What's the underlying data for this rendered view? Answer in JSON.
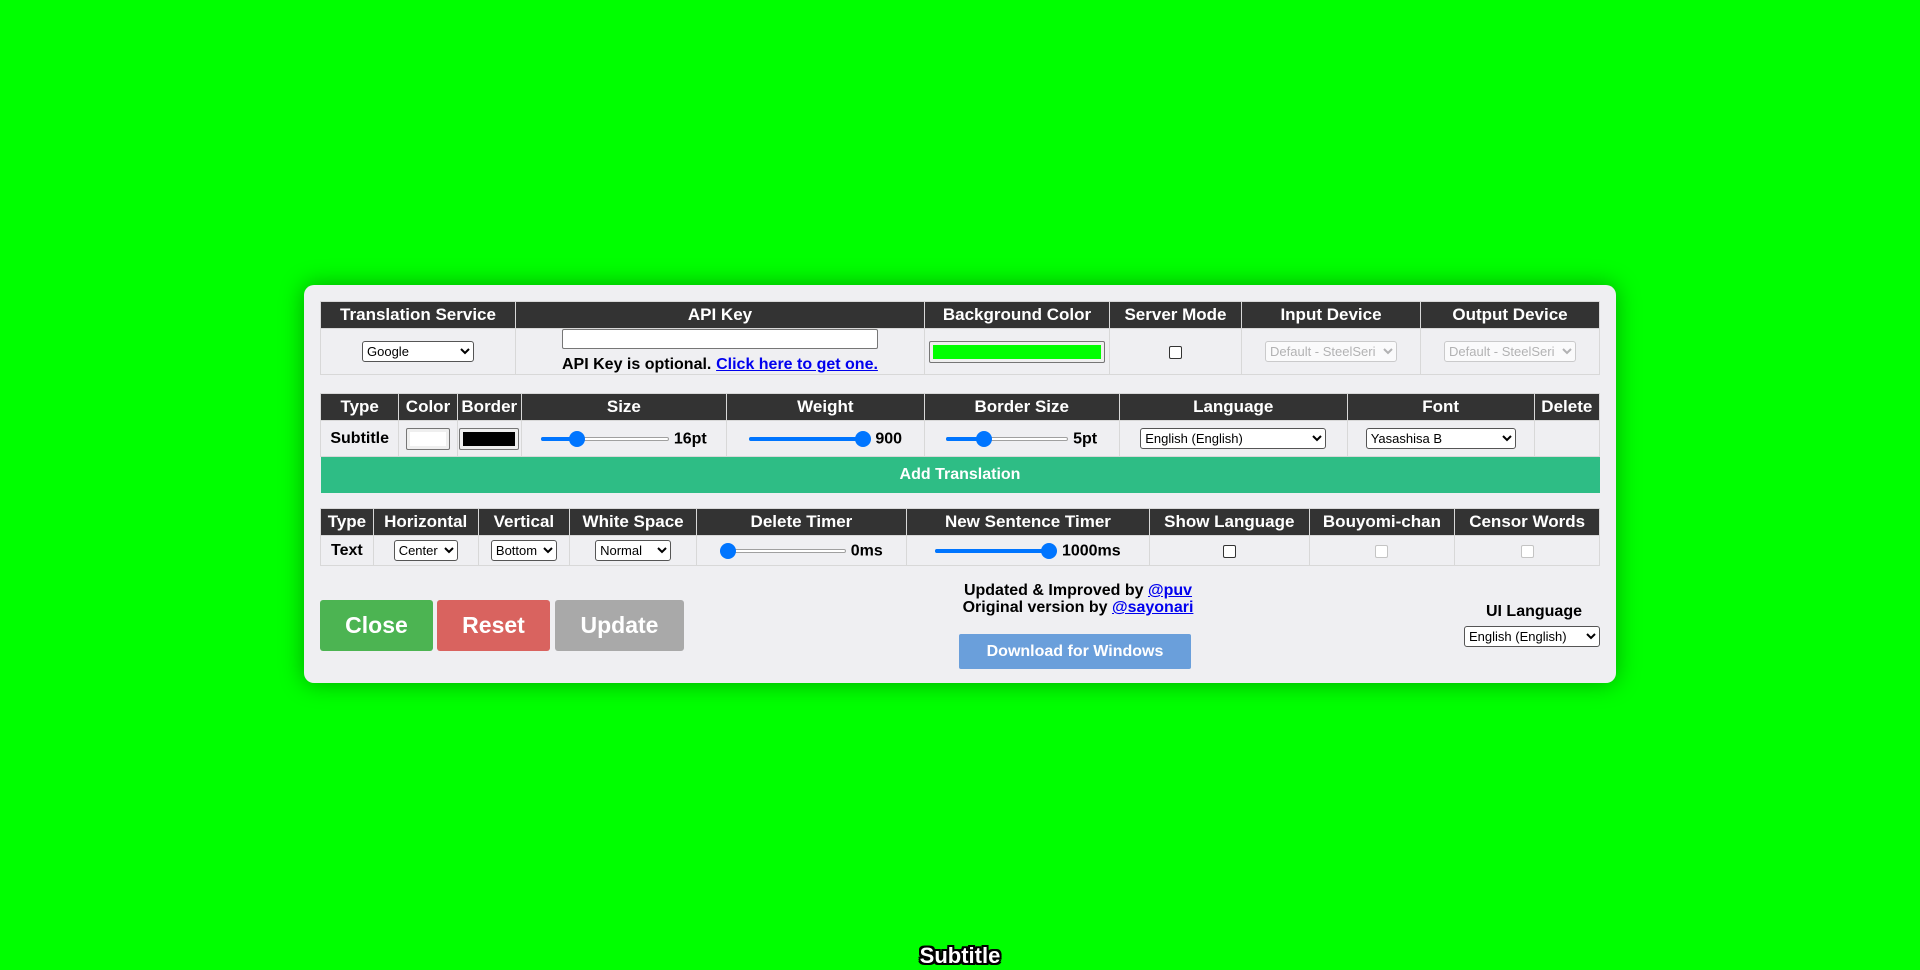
{
  "settings": {
    "headers": [
      "Translation Service",
      "API Key",
      "Background Color",
      "Server Mode",
      "Input Device",
      "Output Device"
    ],
    "translation_service": "Google",
    "api_key_value": "",
    "api_key_note": "API Key is optional.",
    "api_key_link": "Click here to get one.",
    "background_color": "#00ff00",
    "server_mode_checked": false,
    "input_device": "Default - SteelSeri",
    "output_device": "Default - SteelSeri"
  },
  "translation": {
    "headers": [
      "Type",
      "Color",
      "Border",
      "Size",
      "Weight",
      "Border Size",
      "Language",
      "Font",
      "Delete"
    ],
    "type": "Subtitle",
    "color": "#ffffff",
    "border_color": "#000000",
    "size_value": "16pt",
    "size_fraction": 0.25,
    "weight_value": "900",
    "weight_fraction": 1.0,
    "border_size_value": "5pt",
    "border_size_fraction": 0.28,
    "language": "English (English)",
    "font": "Yasashisa B",
    "add_label": "Add Translation"
  },
  "text_settings": {
    "headers": [
      "Type",
      "Horizontal",
      "Vertical",
      "White Space",
      "Delete Timer",
      "New Sentence Timer",
      "Show Language",
      "Bouyomi-chan",
      "Censor Words"
    ],
    "type": "Text",
    "horizontal": "Center",
    "vertical": "Bottom",
    "white_space": "Normal",
    "delete_timer_value": "0ms",
    "delete_timer_fraction": 0.0,
    "new_sentence_timer_value": "1000ms",
    "new_sentence_timer_fraction": 1.0
  },
  "buttons": {
    "close": "Close",
    "reset": "Reset",
    "update": "Update",
    "download": "Download for Windows",
    "close_color": "#4cb452",
    "reset_color": "#d9635f",
    "update_color": "#a9a9a9"
  },
  "credits": {
    "updated_prefix": "Updated & Improved by",
    "updated_link": "@puv",
    "original_prefix": "Original version by",
    "original_link": "@sayonari"
  },
  "ui_language": {
    "label": "UI Language",
    "value": "English (English)"
  },
  "overlay_text": "Subtitle"
}
